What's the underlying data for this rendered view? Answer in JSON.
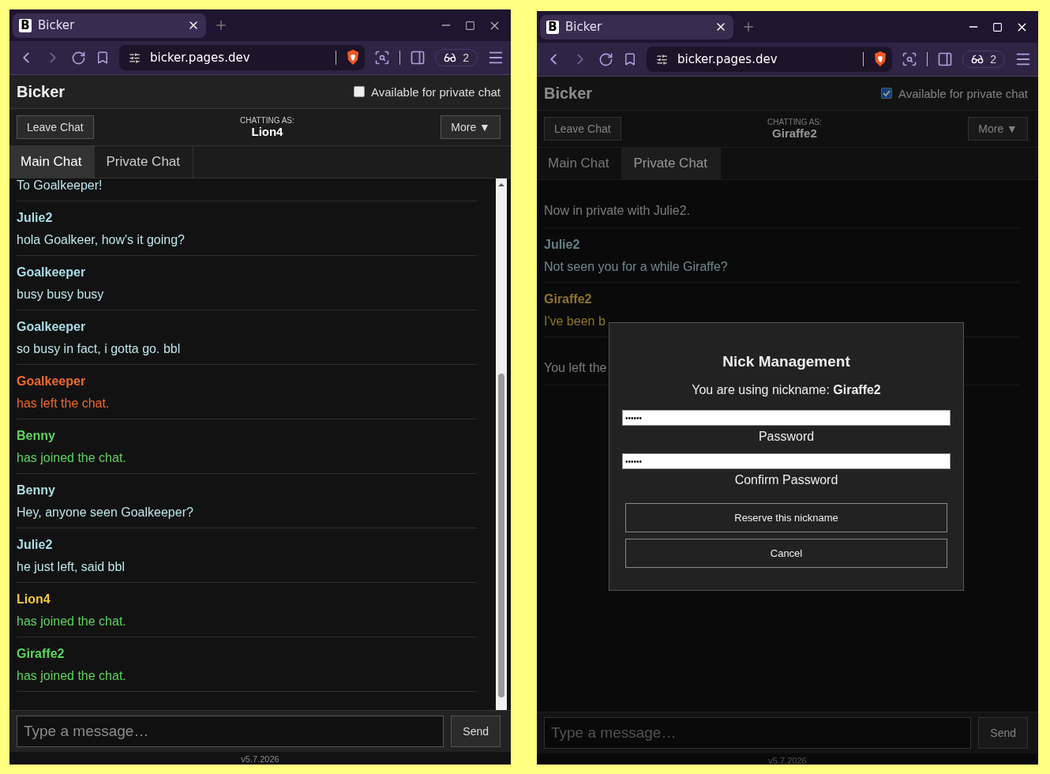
{
  "windows": [
    {
      "browser": {
        "tab_title": "Bicker",
        "tab_logo": "B",
        "url": "bicker.pages.dev",
        "counter": "2",
        "active": false
      },
      "app": {
        "title": "Bicker",
        "private_toggle": {
          "label": "Available for private chat",
          "checked": false
        },
        "leave_button": "Leave Chat",
        "chatting_as_label": "CHATTING AS:",
        "nickname": "Lion4",
        "more_button": "More ▼",
        "tabs": [
          {
            "label": "Main Chat",
            "selected": true
          },
          {
            "label": "Private Chat",
            "selected": false
          }
        ],
        "scrollable": true,
        "messages": [
          {
            "kind": "message",
            "own": false,
            "text": "To Goalkeeper!"
          },
          {
            "kind": "message",
            "own": false,
            "name": "Julie2",
            "text": "hola Goalkeer, how's it going?"
          },
          {
            "kind": "message",
            "own": false,
            "name": "Goalkeeper",
            "text": "busy busy busy"
          },
          {
            "kind": "message",
            "own": false,
            "name": "Goalkeeper",
            "text": "so busy in fact, i gotta go.  bbl"
          },
          {
            "kind": "left",
            "own": false,
            "name": "Goalkeeper",
            "text": "has left the chat."
          },
          {
            "kind": "joined",
            "own": false,
            "name": "Benny",
            "text": "has joined the chat."
          },
          {
            "kind": "message",
            "own": false,
            "name": "Benny",
            "text": "Hey, anyone seen Goalkeeper?"
          },
          {
            "kind": "message",
            "own": false,
            "name": "Julie2",
            "text": "he just left, said bbl"
          },
          {
            "kind": "joined",
            "own": true,
            "name": "Lion4",
            "text": "has joined the chat."
          },
          {
            "kind": "joined",
            "own": false,
            "name": "Giraffe2",
            "text": "has joined the chat."
          }
        ],
        "composer": {
          "placeholder": "Type a message…",
          "send_button": "Send"
        },
        "version": "v5.7.2026"
      }
    },
    {
      "browser": {
        "tab_title": "Bicker",
        "tab_logo": "B",
        "url": "bicker.pages.dev",
        "counter": "2",
        "active": true
      },
      "app": {
        "title": "Bicker",
        "private_toggle": {
          "label": "Available for private chat",
          "checked": true
        },
        "leave_button": "Leave Chat",
        "chatting_as_label": "CHATTING AS:",
        "nickname": "Giraffe2",
        "more_button": "More ▼",
        "tabs": [
          {
            "label": "Main Chat",
            "selected": false
          },
          {
            "label": "Private Chat",
            "selected": true
          }
        ],
        "scrollable": false,
        "messages": [
          {
            "kind": "system",
            "text": "Now in private with Julie2."
          },
          {
            "kind": "message",
            "own": false,
            "name": "Julie2",
            "text": "Not seen you for a while Giraffe?"
          },
          {
            "kind": "message",
            "own": true,
            "name": "Giraffe2",
            "text": "I've been b"
          },
          {
            "kind": "system",
            "text": "You left the"
          }
        ],
        "composer": {
          "placeholder": "Type a message…",
          "send_button": "Send"
        },
        "version": "v5.7.2026",
        "modal": {
          "title": "Nick Management",
          "intro": "You are using nickname: **Giraffe2**",
          "fields": [
            {
              "value": "••••••",
              "label": "Password"
            },
            {
              "value": "••••••",
              "label": "Confirm Password"
            }
          ],
          "buttons": [
            "Reserve this nickname",
            "Cancel"
          ]
        }
      }
    }
  ]
}
